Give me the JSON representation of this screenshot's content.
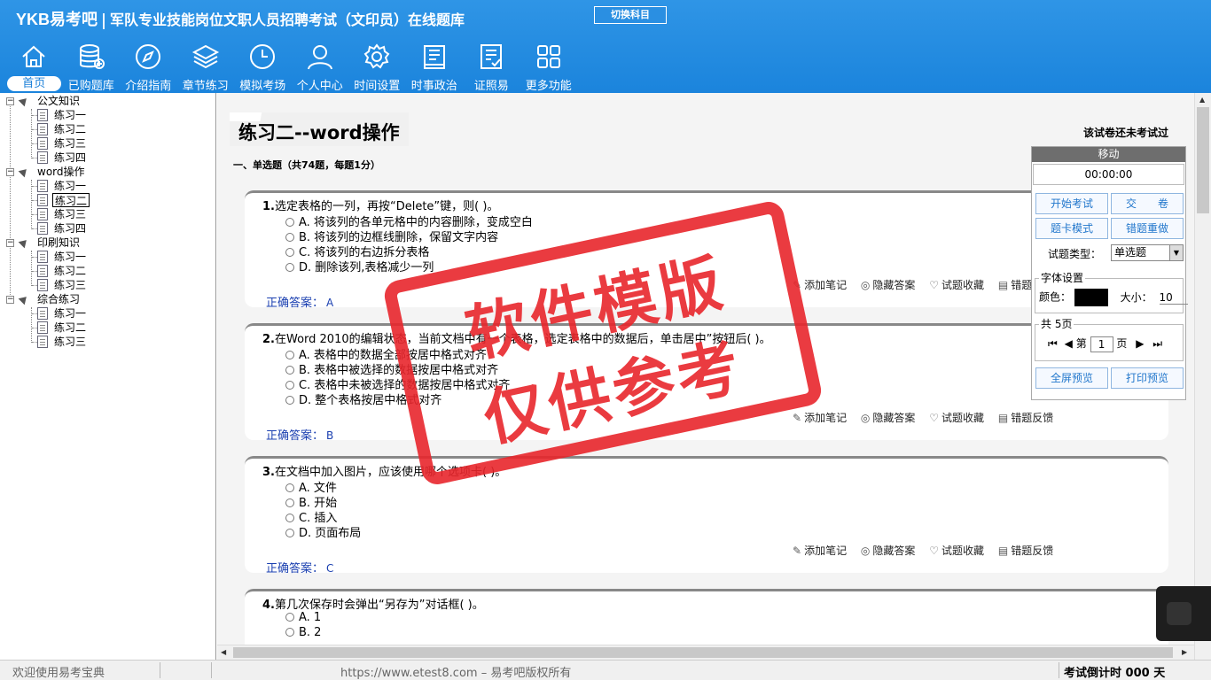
{
  "header": {
    "logo": "YKB易考吧",
    "title": "军队专业技能岗位文职人员招聘考试（文印员）在线题库",
    "switch_label": "切换科目"
  },
  "nav": [
    {
      "label": "首页",
      "icon": "home-icon"
    },
    {
      "label": "已购题库",
      "icon": "database-icon"
    },
    {
      "label": "介绍指南",
      "icon": "compass-icon"
    },
    {
      "label": "章节练习",
      "icon": "layers-icon"
    },
    {
      "label": "模拟考场",
      "icon": "clock-icon"
    },
    {
      "label": "个人中心",
      "icon": "user-icon"
    },
    {
      "label": "时间设置",
      "icon": "gear-icon"
    },
    {
      "label": "时事政治",
      "icon": "news-icon"
    },
    {
      "label": "证照易",
      "icon": "checklist-icon"
    },
    {
      "label": "更多功能",
      "icon": "grid-icon"
    }
  ],
  "tree": {
    "groups": [
      {
        "label": "公文知识",
        "items": [
          "练习一",
          "练习二",
          "练习三",
          "练习四"
        ]
      },
      {
        "label": "word操作",
        "items": [
          "练习一",
          "练习二",
          "练习三",
          "练习四"
        ]
      },
      {
        "label": "印刷知识",
        "items": [
          "练习一",
          "练习二",
          "练习三"
        ]
      },
      {
        "label": "综合练习",
        "items": [
          "练习一",
          "练习二",
          "练习三"
        ]
      }
    ],
    "selected": "word操作/练习二"
  },
  "page": {
    "title": "练习二--word操作",
    "status_note": "该试卷还未考试过",
    "section": "一、单选题（共74题，每题1分）"
  },
  "questions": [
    {
      "num": "1.",
      "text": "选定表格的一列，再按“Delete”键，则( )。",
      "options": [
        "A. 将该列的各单元格中的内容删除，变成空白",
        "B. 将该列的边框线删除，保留文字内容",
        "C. 将该列的右边拆分表格",
        "D. 删除该列,表格减少一列"
      ],
      "answer": "A"
    },
    {
      "num": "2.",
      "text": "在Word 2010的编辑状态，当前文档中有一个表格，选定表格中的数据后，单击居中”按钮后( )。",
      "options": [
        "A. 表格中的数据全部按居中格式对齐",
        "B. 表格中被选择的数据按居中格式对齐",
        "C. 表格中未被选择的数据按居中格式对齐",
        "D. 整个表格按居中格式对齐"
      ],
      "answer": "B"
    },
    {
      "num": "3.",
      "text": "在文档中加入图片，应该使用哪个选项卡( )。",
      "options": [
        "A. 文件",
        "B. 开始",
        "C. 插入",
        "D. 页面布局"
      ],
      "answer": "C"
    },
    {
      "num": "4.",
      "text": "第几次保存时会弹出“另存为”对话框( )。",
      "options": [
        "A. 1",
        "B. 2"
      ],
      "answer": ""
    }
  ],
  "tools": {
    "note": "添加笔记",
    "hide": "隐藏答案",
    "fav": "试题收藏",
    "report": "错题反馈"
  },
  "answer_label": "正确答案：",
  "control": {
    "move": "移动",
    "timer": "00:00:00",
    "start": "开始考试",
    "submit": "交　　卷",
    "card_mode": "题卡模式",
    "redo": "错题重做",
    "type_label": "试题类型：",
    "type_value": "单选题",
    "font_legend": "字体设置",
    "color_label": "颜色：",
    "size_label": "大小：",
    "size_value": "10",
    "pages_legend": "共 5页",
    "page_prefix": "第",
    "page_value": "1",
    "page_suffix": "页",
    "fullscreen": "全屏预览",
    "print": "打印预览"
  },
  "watermark": {
    "line1": "软件模版",
    "line2": "仅供参考"
  },
  "statusbar": {
    "welcome": "欢迎使用易考宝典",
    "copyright": "https://www.etest8.com – 易考吧版权所有",
    "countdown": "考试倒计时 000 天"
  },
  "colors": {
    "header": "#1b84dc",
    "stamp": "#e8262c",
    "answer": "#1a3fb0"
  }
}
